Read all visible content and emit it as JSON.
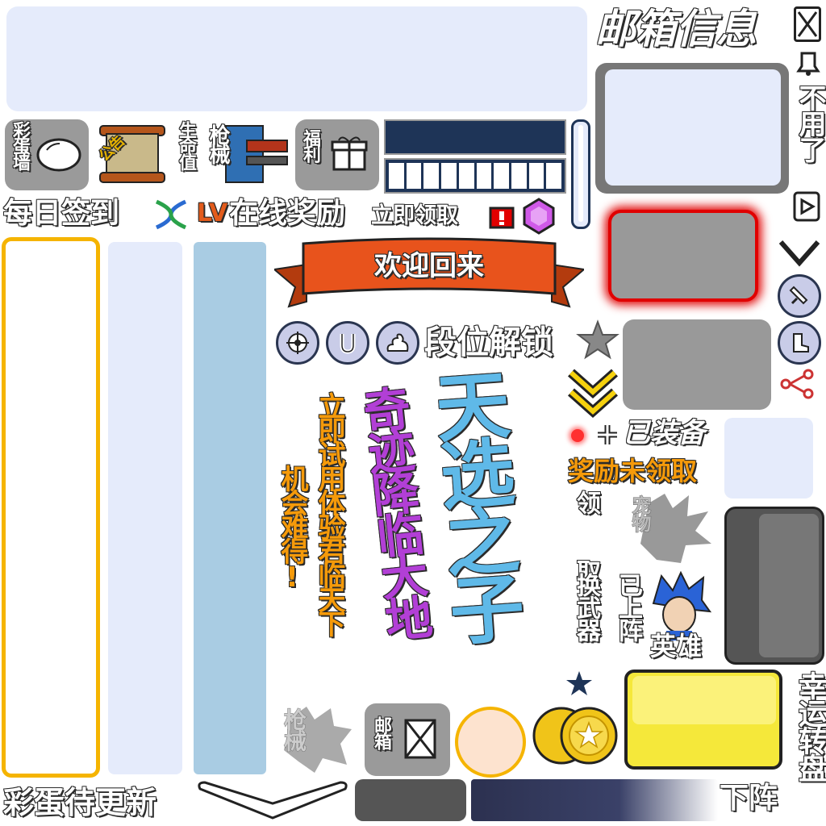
{
  "mail_title": "邮箱信息",
  "not_needed": "不用了",
  "egg_wall": "彩蛋墙",
  "notice": "公告",
  "hp": "生命值",
  "guns": "枪械",
  "welfare": "福利",
  "daily_signin": "每日签到",
  "lv": "LV",
  "online_reward": "在线奖励",
  "claim_now": "立即领取",
  "welcome_back": "欢迎回来",
  "rank_unlock": "段位解锁",
  "equipped": "已装备",
  "reward_unclaimed": "奖励未领取",
  "claim_vertical": "领 取",
  "change_weapon": "换武器",
  "pet": "宠物",
  "deployed": "已上阵",
  "hero": "英雄",
  "slogan_big": "天选之子",
  "slogan_mid": "奇迹降临大地",
  "trial_line1": "立即试用体验君临天下",
  "trial_line2": "机会难得!",
  "guns_grey": "枪械",
  "mailbox": "邮箱",
  "egg_update": "彩蛋待更新",
  "lucky_turntable": "幸运转盘",
  "undeploy": "下阵",
  "colors": {
    "panel_light": "#e5ebfb",
    "panel_blue": "#a9cce3",
    "orange_border": "#f5b400",
    "dark_navy": "#1e3457",
    "ribbon": "#e8531c",
    "gold": "#f0c419",
    "yellow_tile": "#f5e83a",
    "red_glow": "#e00000",
    "orange_text": "#f59a0a",
    "purple_text": "#b23fd6",
    "blue_text": "#5fb9e8"
  },
  "icons": [
    "mail-icon",
    "bell-icon",
    "play-icon",
    "chevron-down-icon",
    "sword-icon",
    "boot-icon",
    "branch-icon",
    "egg-icon",
    "gift-icon",
    "dna-icon",
    "alert-icon",
    "gem-icon",
    "target-icon",
    "magnet-icon",
    "poop-icon",
    "star-icon",
    "double-chevron-icon",
    "plus-icon",
    "coin-icon"
  ]
}
